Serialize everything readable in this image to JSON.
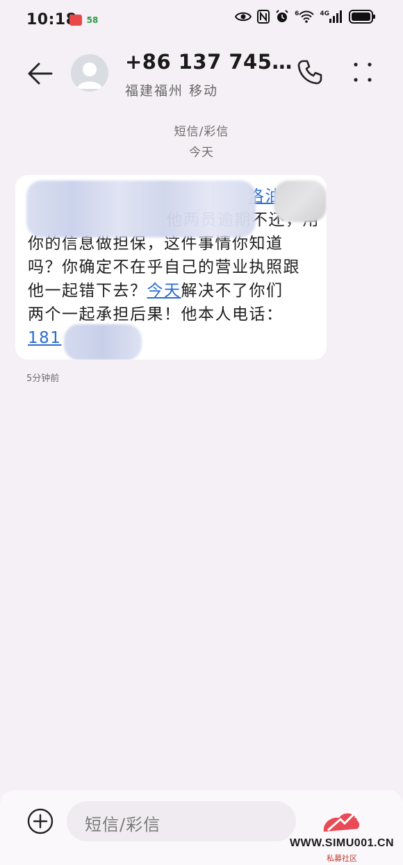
{
  "status_bar": {
    "time": "10:18",
    "app_badges": [
      "",
      "58"
    ],
    "network_label": "4G",
    "wifi_label": "6"
  },
  "header": {
    "contact_name": "+86 137 745…",
    "contact_subtitle": "福建福州 移动"
  },
  "thread": {
    "type_label": "短信/彩信",
    "day_label": "今天"
  },
  "message": {
    "line1_visible": "洛油",
    "line2_visible": "他两员逾期不还，用",
    "line3": "你的信息做担保，这件事情你知道",
    "line4": "吗？你确定不在乎自己的营业执照跟",
    "line5_before": "他一起错下去？",
    "line5_link": "今天",
    "line5_after": "解决不了你们",
    "line6": "两个一起承担后果！他本人电话：",
    "line7_link": "181",
    "time": "5分钟前"
  },
  "composer": {
    "placeholder": "短信/彩信"
  },
  "watermark": {
    "text": "WWW.SIMU001.CN",
    "sub": "私募社区"
  },
  "colors": {
    "background": "#f5f0f5",
    "bubble": "#ffffff",
    "link": "#2a6bd1",
    "badge_red": "#e8484a"
  }
}
